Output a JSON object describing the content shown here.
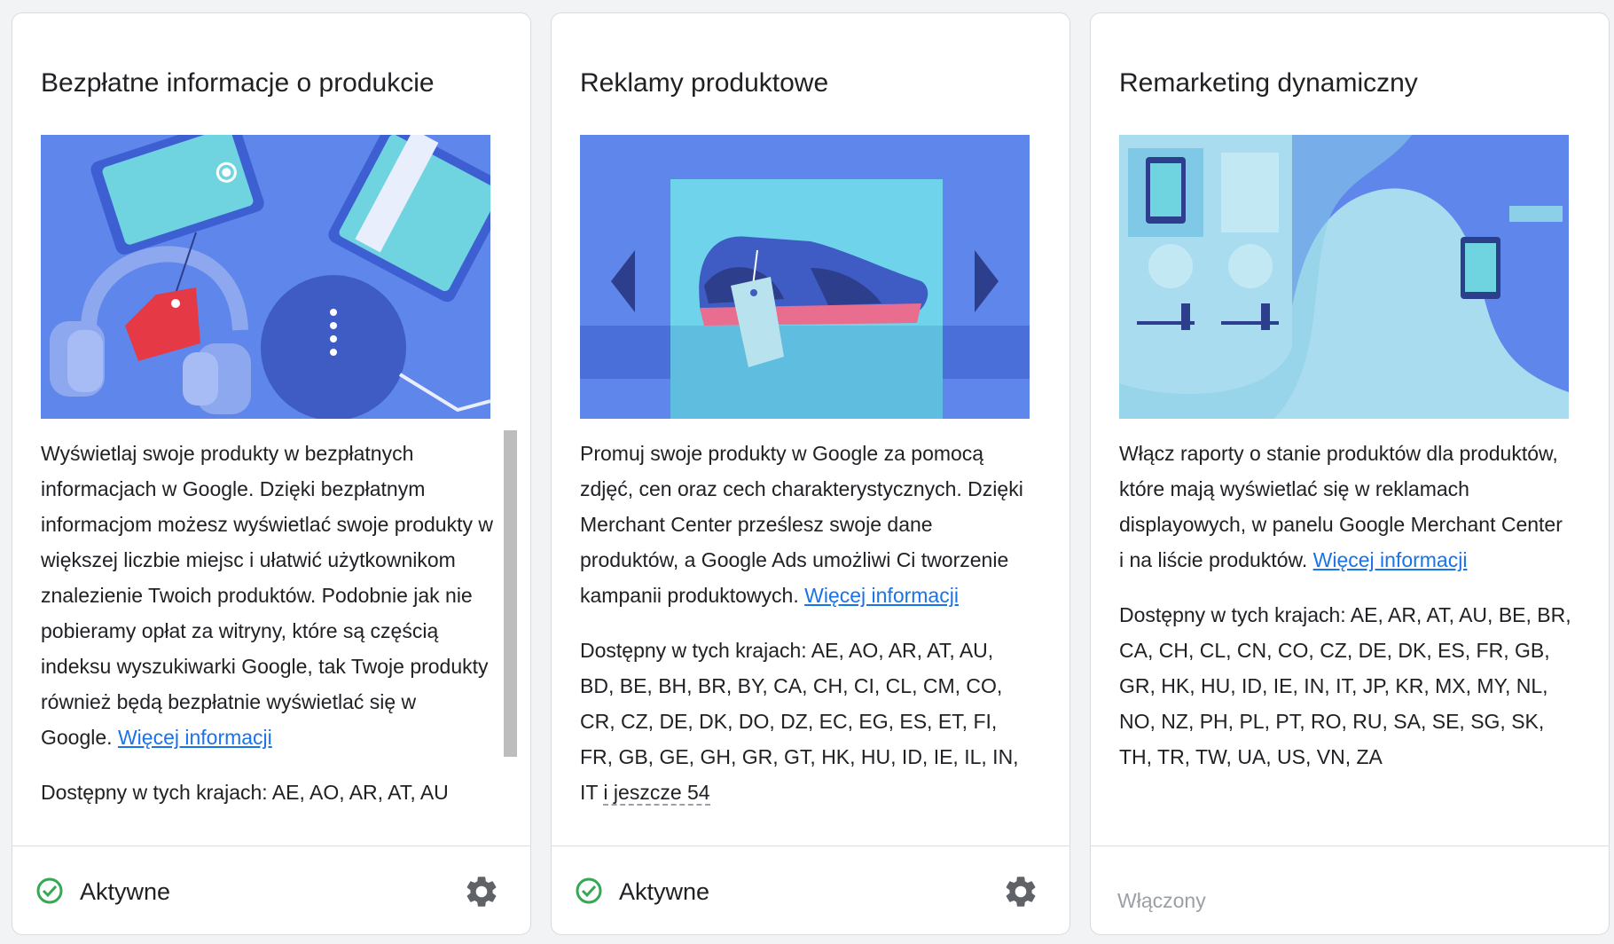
{
  "cards": [
    {
      "title": "Bezpłatne informacje o produkcie",
      "description": "Wyświetlaj swoje produkty w bezpłatnych informacjach w Google. Dzięki bezpłatnym informacjom możesz wyświetlać swoje produkty w większej liczbie miejsc i ułatwić użytkownikom znalezienie Twoich produktów. Podobnie jak nie pobieramy opłat za witryny, które są częścią indeksu wyszukiwarki Google, tak Twoje produkty również będą bezpłatnie wyświetlać się w Google.",
      "learn_more": "Więcej informacji",
      "countries": "Dostępny w tych krajach: AE, AO, AR, AT, AU",
      "status": "Aktywne",
      "settings_icon": "gear-icon",
      "status_icon": "check-circle-icon"
    },
    {
      "title": "Reklamy produktowe",
      "description": "Promuj swoje produkty w Google za pomocą zdjęć, cen oraz cech charakterystycznych. Dzięki Merchant Center prześlesz swoje dane produktów, a Google Ads umożliwi Ci tworzenie kampanii produktowych.",
      "learn_more": "Więcej informacji",
      "countries": "Dostępny w tych krajach: AE, AO, AR, AT, AU, BD, BE, BH, BR, BY, CA, CH, CI, CL, CM, CO, CR, CZ, DE, DK, DO, DZ, EC, EG, ES, ET, FI, FR, GB, GE, GH, GR, GT, HK, HU, ID, IE, IL, IN, IT",
      "more_countries": "i jeszcze 54",
      "status": "Aktywne",
      "settings_icon": "gear-icon",
      "status_icon": "check-circle-icon"
    },
    {
      "title": "Remarketing dynamiczny",
      "description": "Włącz raporty o stanie produktów dla produktów, które mają wyświetlać się w reklamach displayowych, w panelu Google Merchant Center i na liście produktów.",
      "learn_more": "Więcej informacji",
      "countries": "Dostępny w tych krajach: AE, AR, AT, AU, BE, BR, CA, CH, CL, CN, CO, CZ, DE, DK, ES, FR, GB, GR, HK, HU, ID, IE, IN, IT, JP, KR, MX, MY, NL, NO, NZ, PH, PL, PT, RO, RU, SA, SE, SG, SK, TH, TR, TW, UA, US, VN, ZA",
      "status": "Włączony"
    }
  ],
  "colors": {
    "illustration_bg": "#5f86ea",
    "link": "#1a73e8",
    "status_active": "#34a853",
    "status_disabled": "#9aa0a6"
  }
}
